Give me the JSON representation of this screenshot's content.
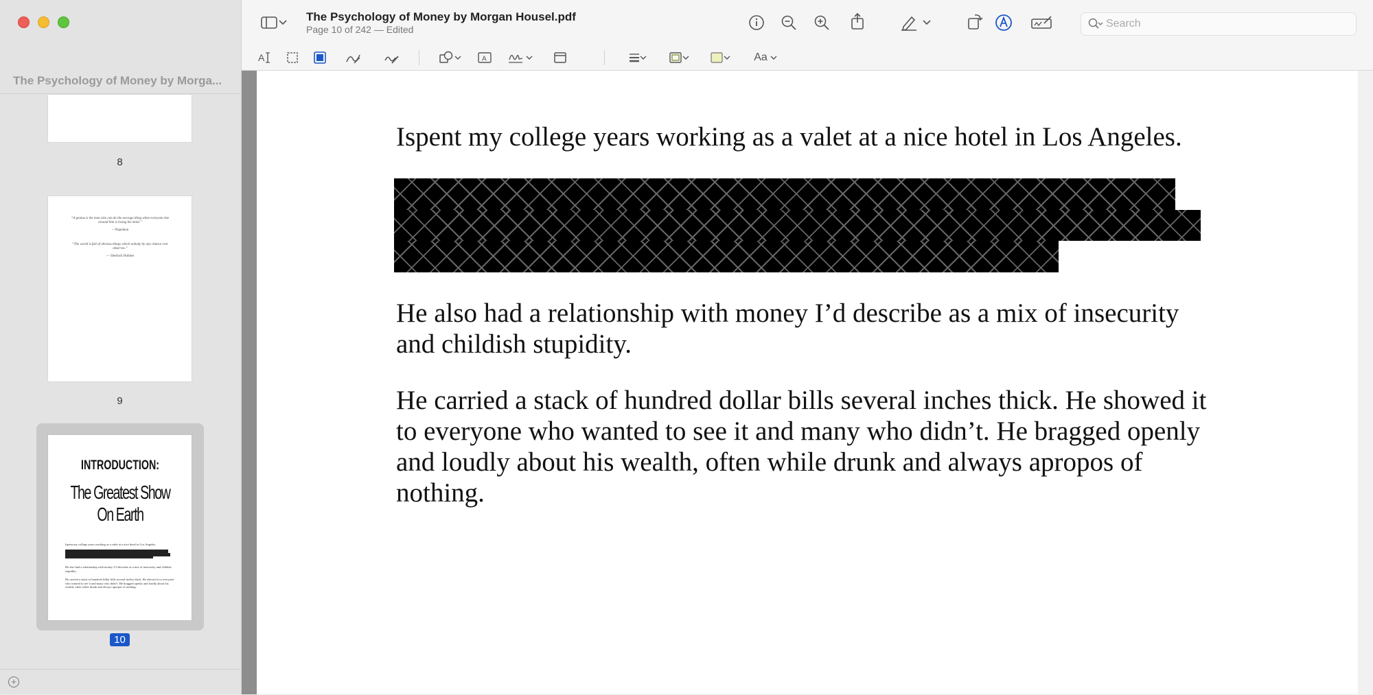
{
  "sidebar": {
    "title": "The Psychology of Money by Morga...",
    "thumbnails": [
      {
        "label": "8"
      },
      {
        "label": "9",
        "quote1": "“A genius is the man who can do the average thing when everyone else around him is losing his mind.”",
        "attr1": "—Napoleon",
        "quote2": "“The world is full of obvious things which nobody by any chance ever observes.”",
        "attr2": "— Sherlock Holmes"
      },
      {
        "label": "10",
        "heading_small": "INTRODUCTION:",
        "heading_big1": "The Greatest Show",
        "heading_big2": "On Earth",
        "line1": "Ispent my college years working as a valet at a nice hotel in Los Angeles.",
        "line2": "He also had a relationship with money I’d describe as a mix of insecurity and childish stupidity.",
        "line3": "He carried a stack of hundred dollar bills several inches thick. He showed it to everyone who wanted to see it and many who didn’t. He bragged openly and loudly about his wealth, often while drunk and always apropos of nothing."
      }
    ]
  },
  "toolbar": {
    "doc_title": "The Psychology of Money by Morgan Housel.pdf",
    "doc_subtitle": "Page 10 of 242 — Edited",
    "search_placeholder": "Search",
    "font_button": "Aa"
  },
  "page": {
    "para1": "Ispent my college years working as a valet at a nice hotel in Los Angeles.",
    "para2_line1": "He also had a relationship with money I’d describe as a mix of insecurity",
    "para2_line2": "and childish stupidity.",
    "para3_line1": "He carried a stack of hundred dollar bills several inches thick. He showed it",
    "para3_line2": "to everyone who wanted to see it and many who didn’t. He bragged openly",
    "para3_line3": "and loudly about his wealth, often while drunk and always apropos of",
    "para3_line4": "nothing."
  },
  "colors": {
    "accent": "#1a57c9",
    "redaction": "#000000",
    "sidebar_bg": "#e3e3e3"
  }
}
